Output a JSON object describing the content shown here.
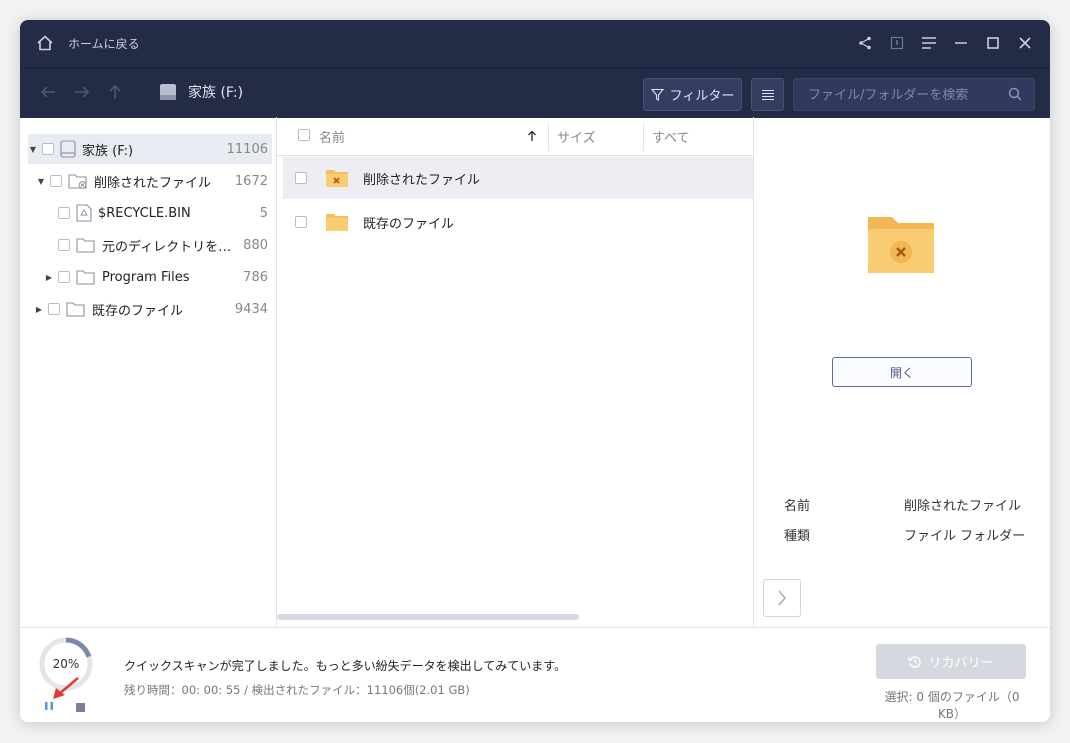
{
  "titlebar": {
    "home_label": "ホームに戻る",
    "controls": [
      "share-icon",
      "info-icon",
      "menu-icon",
      "minimize-icon",
      "maximize-icon",
      "close-icon"
    ]
  },
  "toolbar": {
    "drive_label": "家族 (F:)",
    "filter_label": "フィルター",
    "search_placeholder": "ファイル/フォルダーを検索"
  },
  "tree": [
    {
      "name": "家族 (F:)",
      "count": "11106",
      "expanded": true
    },
    {
      "name": "削除されたファイル",
      "count": "1672",
      "expanded": true
    },
    {
      "name": "$RECYCLE.BIN",
      "count": "5"
    },
    {
      "name": "元のディレクトリを失ったファイル",
      "count": "880"
    },
    {
      "name": "Program Files",
      "count": "786",
      "expanded": false
    },
    {
      "name": "既存のファイル",
      "count": "9434",
      "expanded": false
    }
  ],
  "list": {
    "columns": {
      "name": "名前",
      "size": "サイズ",
      "all": "すべて"
    },
    "rows": [
      {
        "name": "削除されたファイル",
        "selected": true
      },
      {
        "name": "既存のファイル",
        "selected": false
      }
    ]
  },
  "detail": {
    "open_label": "開く",
    "props": [
      {
        "label": "名前",
        "value": "削除されたファイル"
      },
      {
        "label": "種類",
        "value": "ファイル フォルダー"
      }
    ]
  },
  "status": {
    "progress_label": "20%",
    "progress_value": 0.2,
    "message": "クイックスキャンが完了しました。もっと多い紛失データを検出してみています。",
    "detail": "残り時間：00: 00: 55 / 検出されたファイル：11106個(2.01 GB)",
    "recover_label": "リカバリー",
    "selection": "選択: 0 個のファイル（0 KB）"
  },
  "colors": {
    "titlebar": "#242b47",
    "folder": "#f5bf5a",
    "accent_progress": "#4c6fd6"
  }
}
